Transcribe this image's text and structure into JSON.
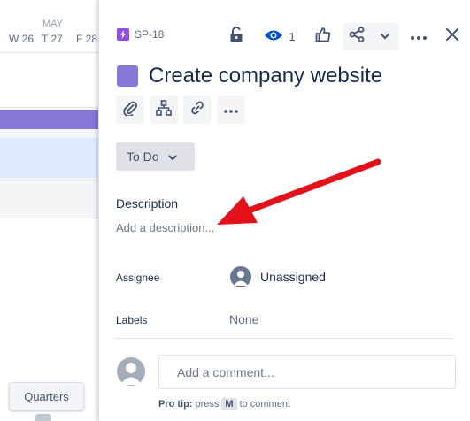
{
  "timeline": {
    "month": "MAY",
    "days": [
      "W 26",
      "T 27",
      "F 28"
    ],
    "quarters_label": "Quarters"
  },
  "issue": {
    "key": "SP-18",
    "title": "Create company website",
    "watch_count": "1",
    "status": "To Do",
    "description_label": "Description",
    "description_placeholder": "Add a description...",
    "assignee_label": "Assignee",
    "assignee_value": "Unassigned",
    "labels_label": "Labels",
    "labels_value": "None",
    "comment_placeholder": "Add a comment...",
    "protip_prefix": "Pro tip:",
    "protip_press": "press",
    "protip_key": "M",
    "protip_suffix": "to comment"
  },
  "icons": {
    "issue_type": "lightning-icon",
    "lock": "lock-icon",
    "watch": "eye-icon",
    "like": "thumbs-up-icon",
    "share": "share-icon",
    "chevron": "chevron-down-icon",
    "more": "more-icon",
    "close": "close-icon",
    "attach": "paperclip-icon",
    "child": "hierarchy-icon",
    "link": "link-icon"
  },
  "colors": {
    "epic": "#8777d9",
    "issue_type": "#904ee2",
    "watch_blue": "#0052cc",
    "arrow_red": "#e3111a"
  }
}
